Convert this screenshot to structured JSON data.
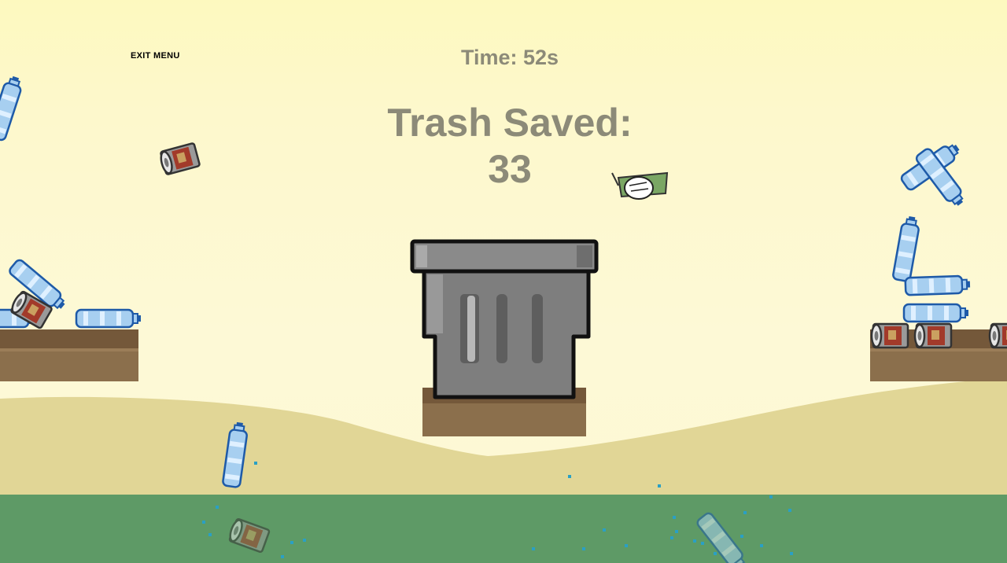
{
  "hud": {
    "exit_label": "EXIT MENU",
    "timer_text": "Time: 52s",
    "score_label": "Trash Saved:",
    "score_value": "33"
  },
  "colors": {
    "sky_top": "#fdf9bf",
    "sand": "#e1d696",
    "water": "#5e9a66",
    "ledge": "#8b6f4c",
    "bin_body": "#7e7e7e",
    "hud_text": "#8c8a78",
    "bottle": "#a6cdef",
    "can_label": "#a23a2a"
  },
  "objects": {
    "trash_bin": "trash-bin",
    "bottle_icon": "plastic-bottle-icon",
    "can_icon": "soda-can-icon",
    "cursor_icon": "hand-cursor-icon"
  }
}
